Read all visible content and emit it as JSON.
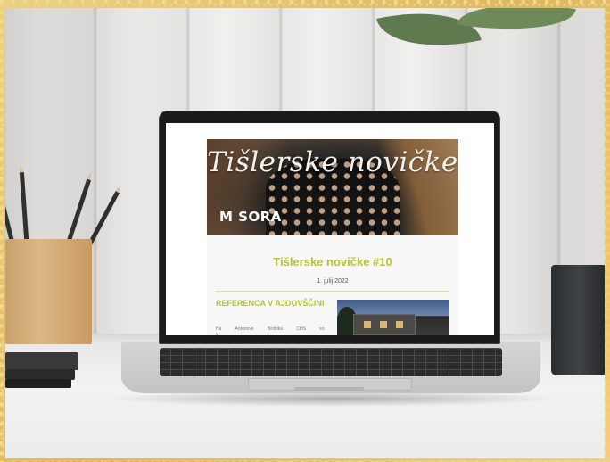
{
  "newsletter": {
    "hero_title": "Tišlerske novičke",
    "brand_logo": "SORA",
    "issue_title": "Tišlerske novičke #10",
    "date": "1. julij 2022",
    "article": {
      "heading": "REFERENCA V AJDOVŠČINI",
      "snippet": "Na Antonove Brdnika CHS so v"
    }
  },
  "colors": {
    "accent": "#b9c431",
    "frame": "#e7c873",
    "laptop_bezel": "#1b1b1b"
  },
  "icons": {
    "brand_mark": "m-logo-icon"
  }
}
